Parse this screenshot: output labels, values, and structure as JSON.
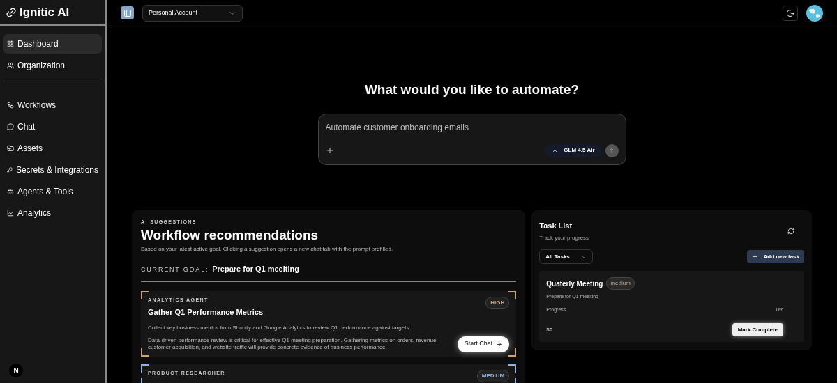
{
  "brand": {
    "name": "Ignitic AI"
  },
  "sidebar": {
    "groups": [
      {
        "items": [
          {
            "label": "Dashboard",
            "selected": true
          },
          {
            "label": "Organization",
            "selected": false
          }
        ]
      },
      {
        "items": [
          {
            "label": "Workflows",
            "selected": false
          },
          {
            "label": "Chat",
            "selected": false
          },
          {
            "label": "Assets",
            "selected": false
          },
          {
            "label": "Secrets & Integrations",
            "selected": false
          },
          {
            "label": "Agents & Tools",
            "selected": false
          },
          {
            "label": "Analytics",
            "selected": false
          }
        ]
      }
    ],
    "footer_badge": "N"
  },
  "header": {
    "account": "Personal Account"
  },
  "prompt": {
    "heading": "What would you like to automate?",
    "placeholder": "Automate customer onboarding emails",
    "model": "GLM 4.5 Air"
  },
  "suggestions": {
    "eyebrow": "AI SUGGESTIONS",
    "title": "Workflow recommendations",
    "subtitle": "Based on your latest active goal. Clicking a suggestion opens a new chat tab with the prompt prefilled.",
    "goal_label": "CURRENT GOAL:",
    "goal": "Prepare for Q1 meeiting",
    "items": [
      {
        "agent": "ANALYTICS AGENT",
        "title": "Gather Q1 Performance Metrics",
        "priority": "HIGH",
        "color": "#c4a484",
        "summary": "Collect key business metrics from Shopify and Google Analytics to review Q1 performance against targets",
        "reason": "Data-driven performance review is critical for effective Q1 meeting preparation. Gathering metrics on orders, revenue, customer acquisition, and website traffic will provide concrete evidence of business performance.",
        "action": "Start Chat"
      },
      {
        "agent": "PRODUCT RESEARCHER",
        "priority": "MEDIUM",
        "color": "#8fb3e0"
      }
    ]
  },
  "tasks": {
    "title": "Task List",
    "subtitle": "Track your progress",
    "filter": "All Tasks",
    "add": "Add new task",
    "items": [
      {
        "title": "Quaterly Meeting",
        "priority": "medium",
        "description": "Prepare for Q1 meeiting",
        "progress_label": "Progress",
        "progress": "0%",
        "amount": "$0",
        "action": "Mark Complete"
      }
    ]
  }
}
